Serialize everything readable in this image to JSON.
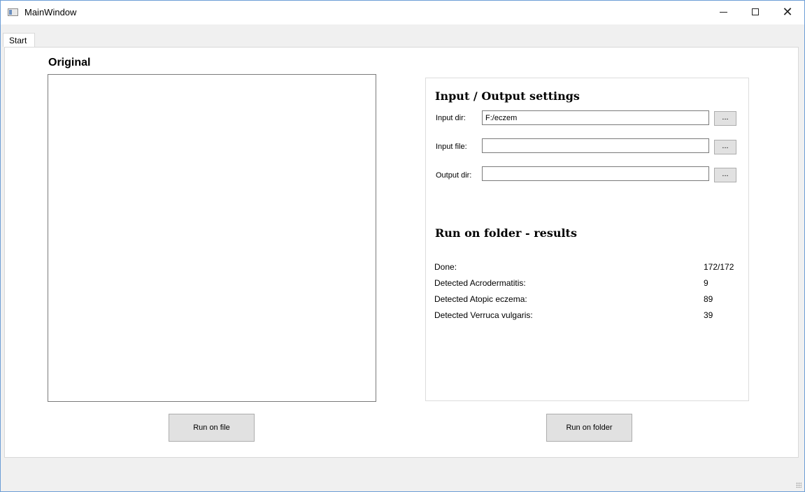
{
  "window": {
    "title": "MainWindow"
  },
  "tabs": [
    {
      "label": "Start"
    }
  ],
  "original": {
    "heading": "Original"
  },
  "io_settings": {
    "heading": "Input / Output settings",
    "input_dir": {
      "label": "Input dir:",
      "value": "F:/eczem",
      "browse": "..."
    },
    "input_file": {
      "label": "Input file:",
      "value": "",
      "browse": "..."
    },
    "output_dir": {
      "label": "Output dir:",
      "value": "",
      "browse": "..."
    }
  },
  "results": {
    "heading": "Run on folder - results",
    "rows": [
      {
        "label": "Done:",
        "value": "172/172"
      },
      {
        "label": "Detected Acrodermatitis:",
        "value": "9"
      },
      {
        "label": "Detected Atopic eczema:",
        "value": "89"
      },
      {
        "label": "Detected Verruca vulgaris:",
        "value": "39"
      }
    ]
  },
  "buttons": {
    "run_on_file": "Run on file",
    "run_on_folder": "Run on folder"
  },
  "icons": {
    "app": "app-window-icon",
    "minimize": "minimize-icon",
    "maximize": "maximize-icon",
    "close": "close-icon"
  }
}
